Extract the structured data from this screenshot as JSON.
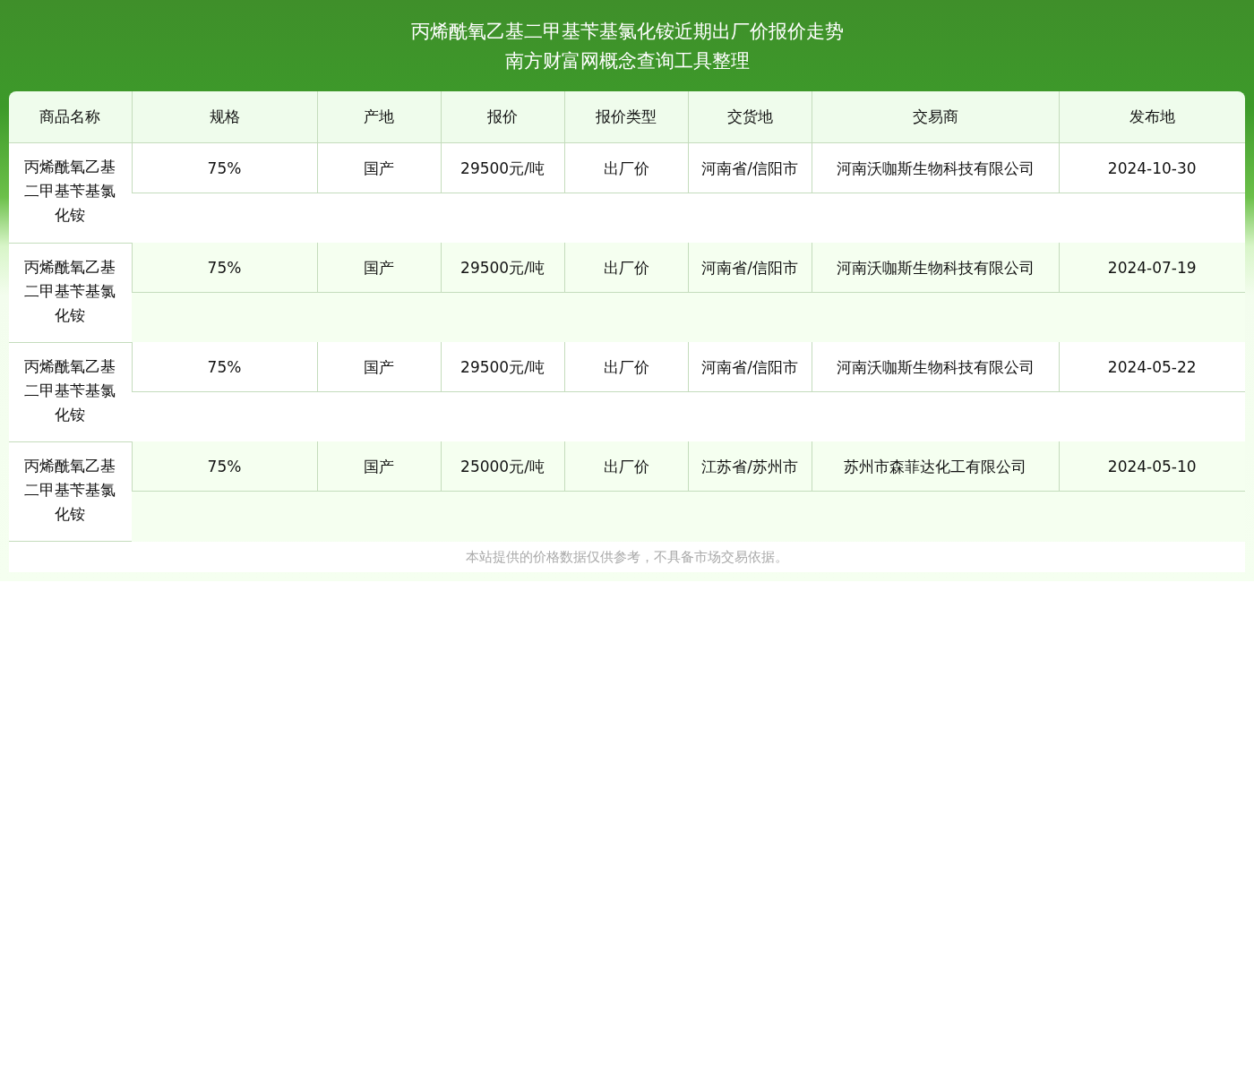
{
  "title": [
    "丙烯酰氧乙基二甲基苄基氯化铵近期出厂价报价走势",
    "南方财富网概念查询工具整理"
  ],
  "table": {
    "columns": [
      "商品名称",
      "规格",
      "产地",
      "报价",
      "报价类型",
      "交货地",
      "交易商",
      "发布地"
    ],
    "rows": [
      [
        "丙烯酰氧乙基二甲基苄基氯化铵",
        "75%",
        "国产",
        "29500元/吨",
        "出厂价",
        "河南省/信阳市",
        "河南沃咖斯生物科技有限公司",
        "2024-10-30"
      ],
      [
        "丙烯酰氧乙基二甲基苄基氯化铵",
        "75%",
        "国产",
        "29500元/吨",
        "出厂价",
        "河南省/信阳市",
        "河南沃咖斯生物科技有限公司",
        "2024-07-19"
      ],
      [
        "丙烯酰氧乙基二甲基苄基氯化铵",
        "75%",
        "国产",
        "29500元/吨",
        "出厂价",
        "河南省/信阳市",
        "河南沃咖斯生物科技有限公司",
        "2024-05-22"
      ],
      [
        "丙烯酰氧乙基二甲基苄基氯化铵",
        "75%",
        "国产",
        "25000元/吨",
        "出厂价",
        "江苏省/苏州市",
        "苏州市森菲达化工有限公司",
        "2024-05-10"
      ]
    ]
  },
  "disclaimer": "本站提供的价格数据仅供参考，不具备市场交易依据。"
}
